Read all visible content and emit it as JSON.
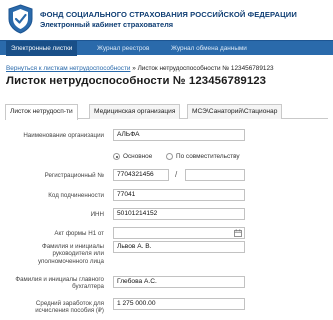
{
  "header": {
    "org_name": "ФОНД СОЦИАЛЬНОГО СТРАХОВАНИЯ РОССИЙСКОЙ ФЕДЕРАЦИИ",
    "org_sub": "Электронный кабинет страхователя",
    "logo_icon": "fss-emblem-icon"
  },
  "nav": {
    "items": [
      {
        "label": "Электронные листки",
        "active": true
      },
      {
        "label": "Журнал реестров",
        "active": false
      },
      {
        "label": "Журнал обмена данными",
        "active": false
      }
    ]
  },
  "breadcrumb": {
    "back_link": "Вернуться к листкам нетрудоспособности",
    "separator": " » ",
    "current": "Листок нетрудоспособности № 123456789123"
  },
  "page_title": "Листок нетрудоспособности № 123456789123",
  "tabs": [
    {
      "label": "Листок нетрудосп-ти",
      "active": true
    },
    {
      "label": "Медицинская организация",
      "active": false
    },
    {
      "label": "МСЭ\\Санаторий\\Стационар",
      "active": false
    }
  ],
  "form": {
    "org_name_label": "Наименование организации",
    "org_name_value": "АЛЬФА",
    "radio_main": "Основное",
    "radio_secondary": "По совместительству",
    "reg_label": "Регистрационный №",
    "reg_value": "7704321456",
    "reg_suffix_value": "",
    "slash": "/",
    "code_label": "Код подчиненности",
    "code_value": "77041",
    "inn_label": "ИНН",
    "inn_value": "50101214152",
    "act_label": "Акт формы Н1 от",
    "act_value": "",
    "head_label": "Фамилия и инициалы руководителя или уполномоченного лица",
    "head_value": "Львов А. В.",
    "accountant_label": "Фамилия и инициалы главного бухгалтера",
    "accountant_value": "Глебова А.С.",
    "salary_label": "Средний заработок для исчисления пособия (₽)",
    "salary_value": "1 275 000.00"
  }
}
